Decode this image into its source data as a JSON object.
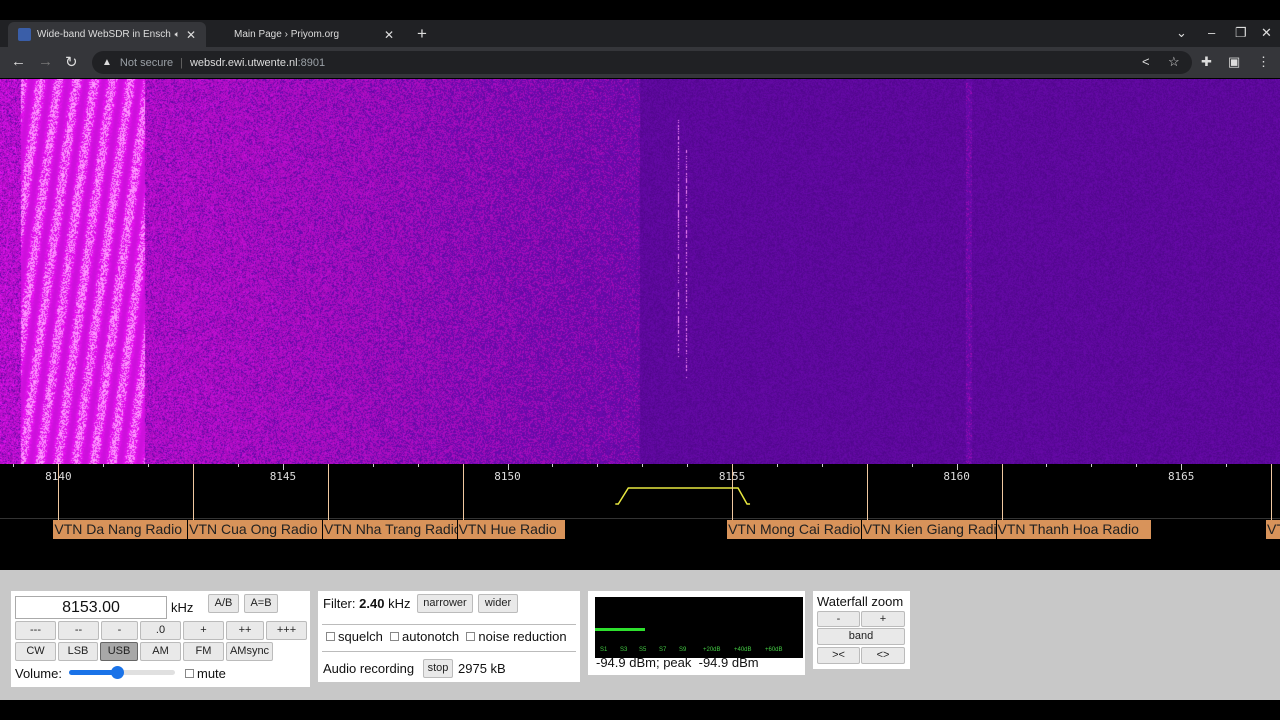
{
  "browser": {
    "tabs": [
      {
        "title": "Wide-band WebSDR in Ensch",
        "active": true,
        "audio": true
      },
      {
        "title": "Main Page › Priyom.org",
        "active": false
      }
    ],
    "security": "Not secure",
    "url_host": "websdr.ewi.utwente.nl",
    "url_port": ":8901"
  },
  "scale": {
    "min_khz": 8138.7,
    "max_khz": 8167.2,
    "labels": [
      "8140",
      "8145",
      "8150",
      "8155",
      "8160",
      "8165"
    ],
    "label_values": [
      8140,
      8145,
      8150,
      8155,
      8160,
      8165
    ],
    "passband_khz": [
      8152.4,
      8155.4
    ]
  },
  "stations": [
    {
      "name": "VTN Da Nang Radio",
      "khz": 8140
    },
    {
      "name": "VTN Cua Ong Radio",
      "khz": 8143
    },
    {
      "name": "VTN Nha Trang Radio",
      "khz": 8146
    },
    {
      "name": "VTN Hue Radio",
      "khz": 8149
    },
    {
      "name": "VTN Mong Cai Radio",
      "khz": 8155
    },
    {
      "name": "VTN Kien Giang Radio",
      "khz": 8158
    },
    {
      "name": "VTN Thanh Hoa Radio",
      "khz": 8161
    },
    {
      "name": "VTN",
      "khz": 8167
    }
  ],
  "tuning": {
    "frequency": "8153.00",
    "unit": "kHz",
    "ab": "A/B",
    "aeqb": "A=B",
    "steps": [
      "---",
      "--",
      "-",
      ".0",
      "+",
      "++",
      "+++"
    ],
    "modes": [
      "CW",
      "LSB",
      "USB",
      "AM",
      "FM",
      "AMsync"
    ],
    "selected_mode": "USB",
    "volume_label": "Volume:",
    "volume": 0.45,
    "mute": "mute"
  },
  "filter": {
    "label": "Filter:",
    "value": "2.40",
    "unit": "kHz",
    "narrower": "narrower",
    "wider": "wider",
    "options": [
      "squelch",
      "autonotch",
      "noise reduction"
    ],
    "recording_label": "Audio recording",
    "stop": "stop",
    "size": "2975 kB"
  },
  "smeter": {
    "level_fraction": 0.24,
    "scale": [
      "S1",
      "S3",
      "S5",
      "S7",
      "S9",
      "+20dB",
      "+40dB",
      "+60dB"
    ],
    "readout": "-94.9 dBm; peak  -94.9 dBm"
  },
  "zoom": {
    "title": "Waterfall zoom",
    "minus": "-",
    "plus": "+",
    "band": "band",
    "narrow": "><",
    "wide": "<>"
  }
}
